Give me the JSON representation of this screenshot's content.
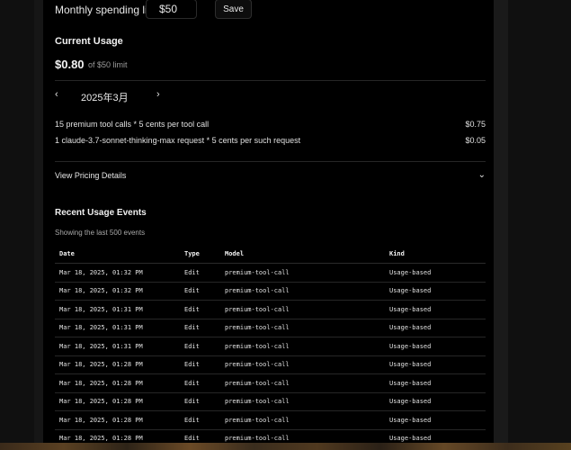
{
  "spending": {
    "label": "Monthly spending limit:",
    "value": "$50",
    "save_label": "Save"
  },
  "current_usage": {
    "title": "Current Usage",
    "amount": "$0.80",
    "limit_text": "of $50 limit"
  },
  "month_nav": {
    "prev_icon": "chevron-left-icon",
    "label": "2025年3月",
    "next_icon": "chevron-right-icon"
  },
  "usage_items": [
    {
      "description": "15 premium tool calls * 5 cents per tool call",
      "price": "$0.75"
    },
    {
      "description": "1 claude-3.7-sonnet-thinking-max request * 5 cents per such request",
      "price": "$0.05"
    }
  ],
  "pricing": {
    "label": "View Pricing Details",
    "icon": "chevron-down-icon"
  },
  "recent": {
    "title": "Recent Usage Events",
    "subtitle": "Showing the last 500 events",
    "columns": [
      "Date",
      "Type",
      "Model",
      "Kind"
    ],
    "rows": [
      [
        "Mar 18, 2025, 01:32 PM",
        "Edit",
        "premium-tool-call",
        "Usage-based"
      ],
      [
        "Mar 18, 2025, 01:32 PM",
        "Edit",
        "premium-tool-call",
        "Usage-based"
      ],
      [
        "Mar 18, 2025, 01:31 PM",
        "Edit",
        "premium-tool-call",
        "Usage-based"
      ],
      [
        "Mar 18, 2025, 01:31 PM",
        "Edit",
        "premium-tool-call",
        "Usage-based"
      ],
      [
        "Mar 18, 2025, 01:31 PM",
        "Edit",
        "premium-tool-call",
        "Usage-based"
      ],
      [
        "Mar 18, 2025, 01:28 PM",
        "Edit",
        "premium-tool-call",
        "Usage-based"
      ],
      [
        "Mar 18, 2025, 01:28 PM",
        "Edit",
        "premium-tool-call",
        "Usage-based"
      ],
      [
        "Mar 18, 2025, 01:28 PM",
        "Edit",
        "premium-tool-call",
        "Usage-based"
      ],
      [
        "Mar 18, 2025, 01:28 PM",
        "Edit",
        "premium-tool-call",
        "Usage-based"
      ],
      [
        "Mar 18, 2025, 01:28 PM",
        "Edit",
        "premium-tool-call",
        "Usage-based"
      ]
    ]
  }
}
